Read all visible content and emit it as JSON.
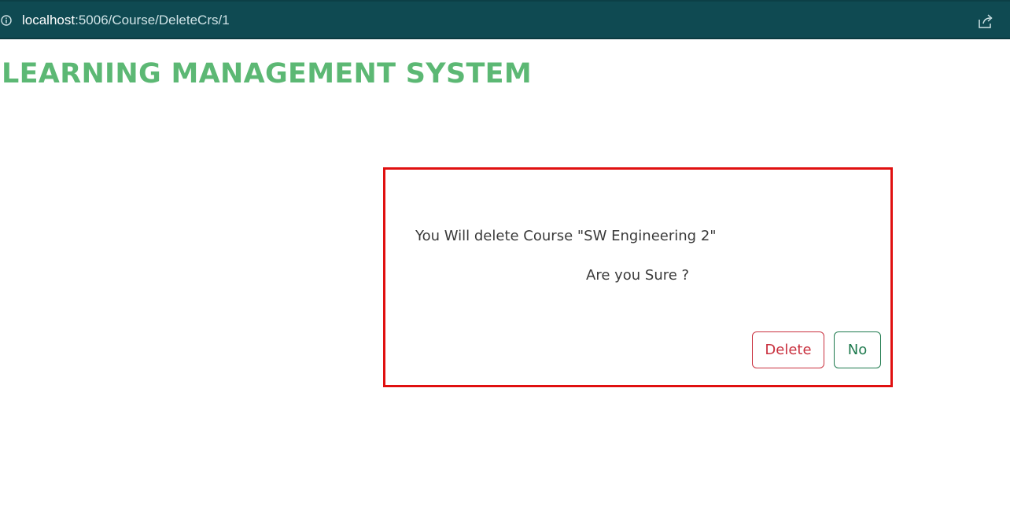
{
  "browser": {
    "url_host": "localhost",
    "url_path": ":5006/Course/DeleteCrs/1",
    "icons": [
      "info-icon",
      "share-icon"
    ]
  },
  "app": {
    "title": "LEARNING MANAGEMENT SYSTEM"
  },
  "dialog": {
    "message": "You Will delete Course \"SW Engineering 2\"",
    "question": "Are you Sure ?",
    "delete_label": "Delete",
    "no_label": "No"
  },
  "colors": {
    "address_bar": "#0f4a52",
    "title": "#5cb874",
    "dialog_border": "#e01010",
    "delete": "#c9303e",
    "no": "#1e7a4e"
  }
}
